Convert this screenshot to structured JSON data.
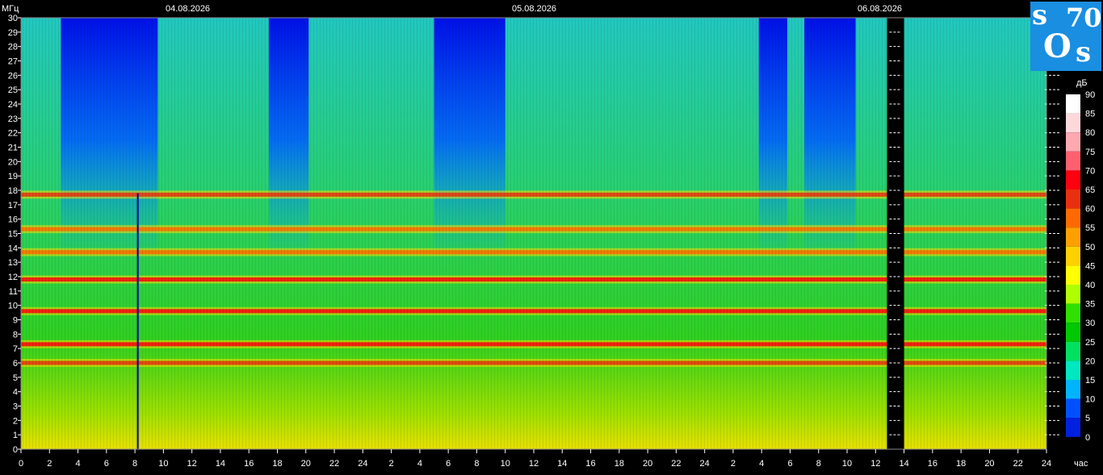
{
  "chart_data": {
    "type": "heatmap",
    "title": "",
    "ylabel": "МГц",
    "xlabel": "час",
    "dates": [
      "04.08.2026",
      "05.08.2026",
      "06.08.2026"
    ],
    "y_ticks": [
      0,
      1,
      2,
      3,
      4,
      5,
      6,
      7,
      8,
      9,
      10,
      11,
      12,
      13,
      14,
      15,
      16,
      17,
      18,
      19,
      20,
      21,
      22,
      23,
      24,
      25,
      26,
      27,
      28,
      29,
      30
    ],
    "ylim": [
      0,
      30
    ],
    "x_tick_labels": [
      "0",
      "2",
      "4",
      "6",
      "8",
      "10",
      "12",
      "14",
      "16",
      "18",
      "20",
      "22",
      "24",
      "2",
      "4",
      "6",
      "8",
      "10",
      "12",
      "14",
      "16",
      "18",
      "20",
      "22",
      "24",
      "2",
      "4",
      "6",
      "8",
      "10",
      "12",
      "14",
      "16",
      "18",
      "20",
      "22",
      "24"
    ],
    "x_range_hours": [
      0,
      72
    ],
    "data_gap_hours": [
      60.8,
      62.0
    ],
    "marker_hour": 8.2,
    "colorbar": {
      "unit": "дБ",
      "ticks": [
        "90",
        "85",
        "80",
        "75",
        "70",
        "65",
        "60",
        "55",
        "50",
        "45",
        "40",
        "35",
        "30",
        "25",
        "20",
        "15",
        "10",
        "5",
        "0"
      ],
      "colors": [
        "#ffffff",
        "#ffd8dc",
        "#ffa8b0",
        "#ff6070",
        "#ff0010",
        "#e83010",
        "#ff6a00",
        "#ffa000",
        "#ffd000",
        "#ffff00",
        "#b0ff00",
        "#30e000",
        "#00c800",
        "#00e060",
        "#00e8c0",
        "#00b4ff",
        "#0050ff",
        "#0020e0",
        "#0000c0"
      ]
    },
    "bands_mhz": [
      {
        "center": 17.7,
        "level_db": 65
      },
      {
        "center": 15.3,
        "level_db": 62
      },
      {
        "center": 13.7,
        "level_db": 62
      },
      {
        "center": 11.8,
        "level_db": 70
      },
      {
        "center": 9.6,
        "level_db": 72
      },
      {
        "center": 7.3,
        "level_db": 68
      },
      {
        "center": 6.0,
        "level_db": 65
      }
    ]
  },
  "logo": {
    "t1": "s",
    "t2": "70",
    "t3": "O",
    "t4": "s"
  }
}
